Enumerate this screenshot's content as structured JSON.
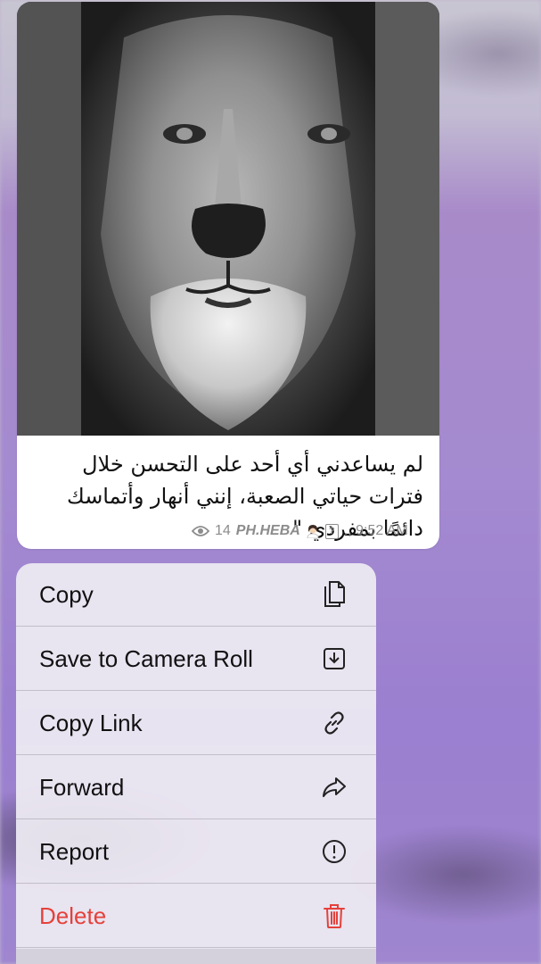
{
  "message": {
    "caption": "لم يساعدني أي أحد على التحسن خلال فترات حياتي الصعبة، إنني أنهار وأتماسك دائمًا بمفردي \"",
    "views": "14",
    "author": "PH.HEBA",
    "author_suffix": "., 9:52 AM"
  },
  "menu": {
    "items": [
      {
        "label": "Copy",
        "icon": "copy-icon"
      },
      {
        "label": "Save to Camera Roll",
        "icon": "download-icon"
      },
      {
        "label": "Copy Link",
        "icon": "link-icon"
      },
      {
        "label": "Forward",
        "icon": "forward-icon"
      },
      {
        "label": "Report",
        "icon": "report-icon"
      },
      {
        "label": "Delete",
        "icon": "trash-icon"
      }
    ]
  },
  "colors": {
    "delete": "#e5413b",
    "meta": "#8c8c8c",
    "menu_bg": "#ece9f1"
  }
}
